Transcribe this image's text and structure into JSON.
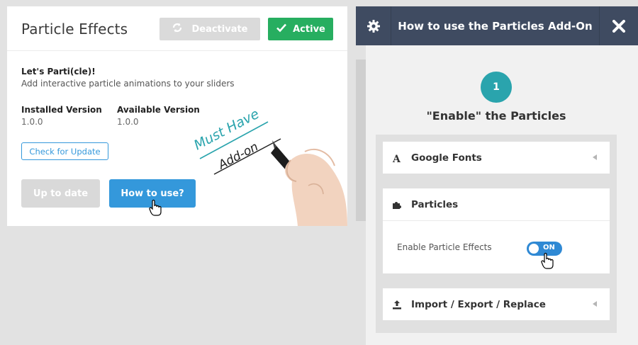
{
  "card": {
    "title": "Particle Effects",
    "deactivate_label": "Deactivate",
    "active_label": "Active",
    "tagline": "Let's Parti(cle)!",
    "description": "Add interactive particle animations to your sliders",
    "installed_label": "Installed Version",
    "installed_value": "1.0.0",
    "available_label": "Available Version",
    "available_value": "1.0.0",
    "check_update_label": "Check for Update",
    "up_to_date_label": "Up to date",
    "how_to_use_label": "How to use?",
    "illustration_line1": "Must Have",
    "illustration_line2": "Add-on"
  },
  "panel": {
    "title": "How to use the Particles Add-On",
    "step_number": "1",
    "step_title": "\"Enable\" the Particles",
    "sections": {
      "google_fonts": "Google Fonts",
      "particles": "Particles",
      "import_export": "Import / Export / Replace"
    },
    "option_label": "Enable Particle Effects",
    "toggle_text": "ON"
  },
  "colors": {
    "active_green": "#27ae60",
    "primary_blue": "#3498db",
    "panel_header": "#3f4b61",
    "step_teal": "#2aa4ad",
    "toggle_blue": "#2f89d4"
  },
  "icons": [
    "refresh-icon",
    "check-icon",
    "gear-icon",
    "close-icon",
    "font-icon",
    "puzzle-icon",
    "upload-icon",
    "hand-cursor-icon",
    "pen-hand-illustration"
  ]
}
